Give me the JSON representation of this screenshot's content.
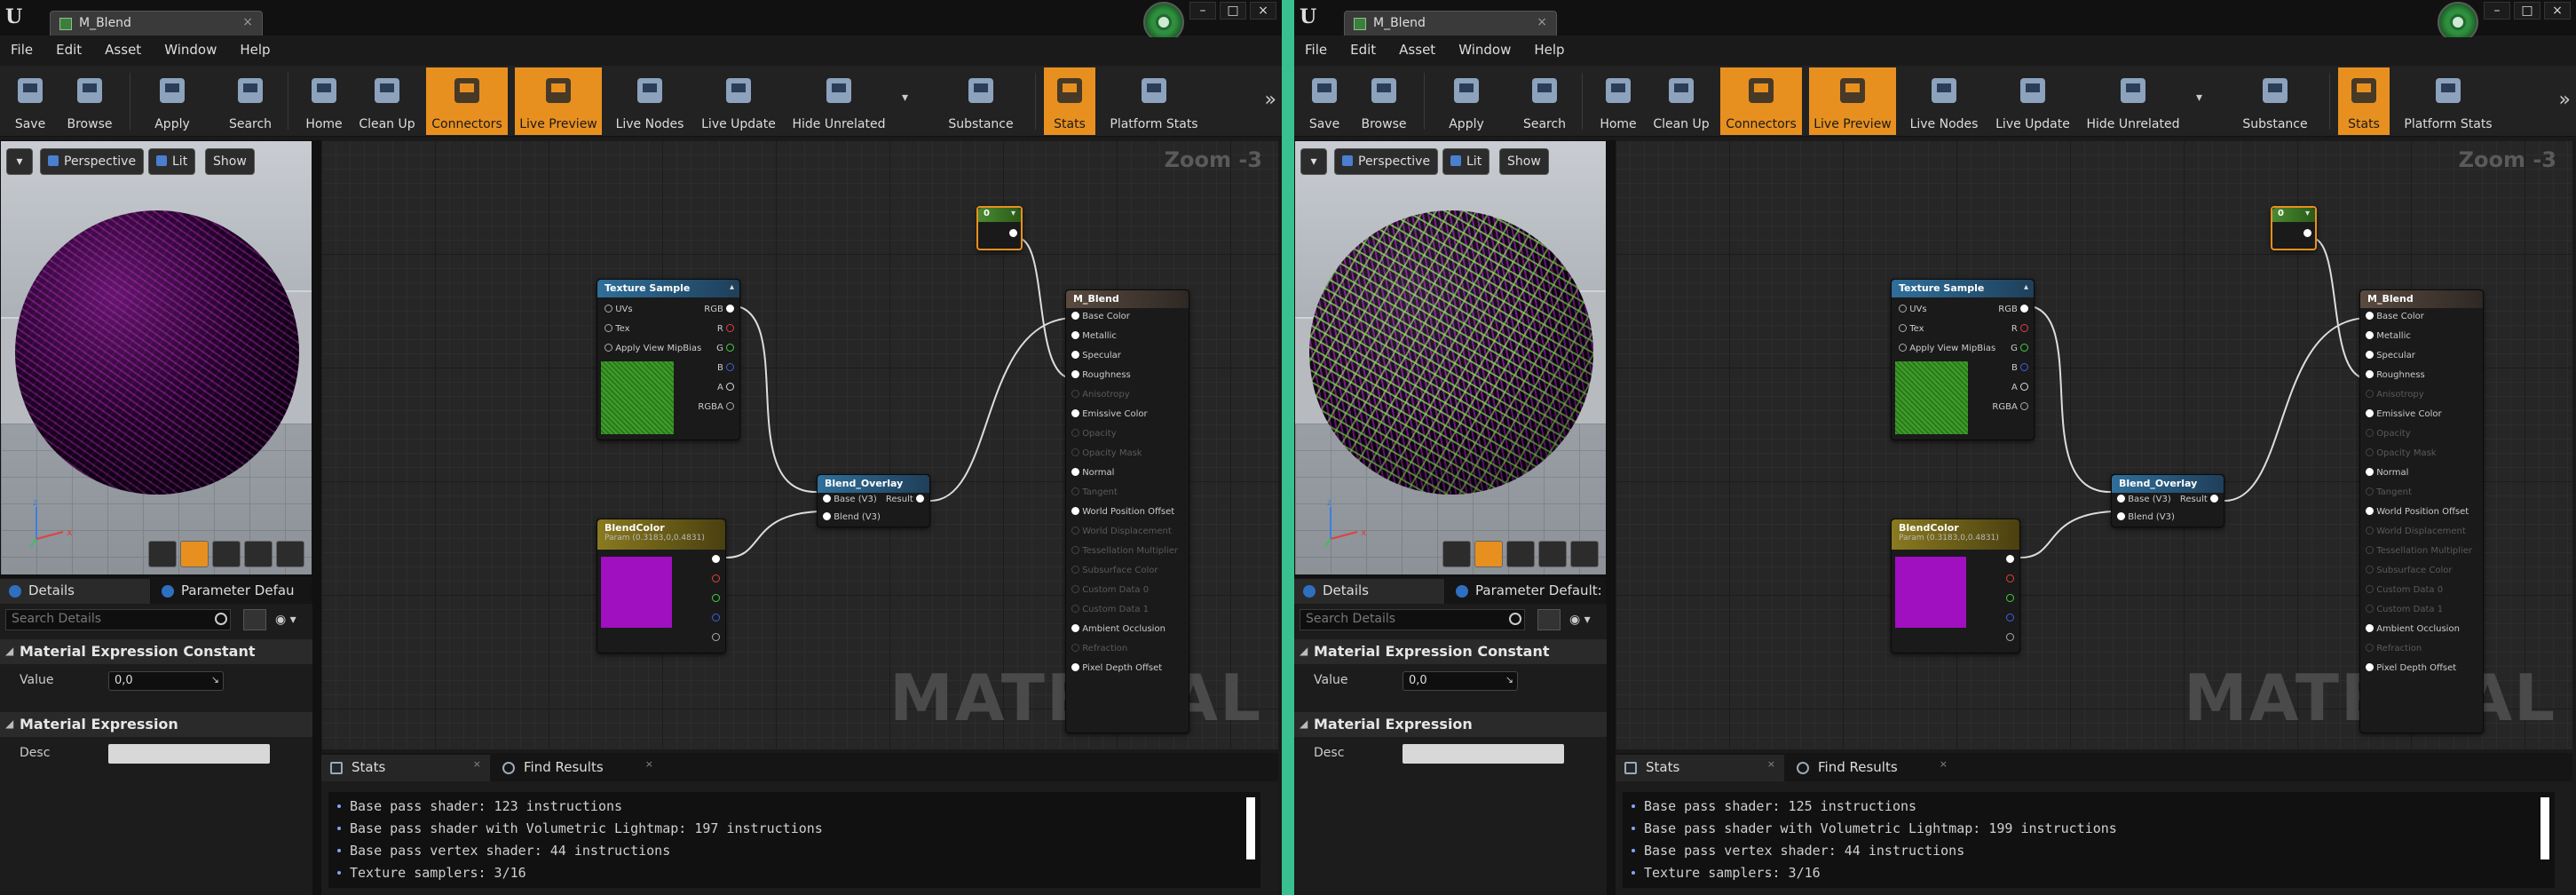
{
  "panes": [
    {
      "tab_title": "M_Blend",
      "tab_close": "×",
      "menu": [
        "File",
        "Edit",
        "Asset",
        "Window",
        "Help"
      ],
      "toolbar": [
        {
          "label": "Save",
          "icon": "save-icon",
          "active": false
        },
        {
          "label": "Browse",
          "icon": "browse-icon",
          "active": false
        },
        {
          "label": "Apply",
          "icon": "apply-icon",
          "active": false
        },
        {
          "label": "Search",
          "icon": "search-icon",
          "active": false
        },
        {
          "label": "Home",
          "icon": "home-icon",
          "active": false
        },
        {
          "label": "Clean Up",
          "icon": "clean-up-icon",
          "active": false
        },
        {
          "label": "Connectors",
          "icon": "connectors-icon",
          "active": true
        },
        {
          "label": "Live Preview",
          "icon": "live-preview-icon",
          "active": true
        },
        {
          "label": "Live Nodes",
          "icon": "live-nodes-icon",
          "active": false
        },
        {
          "label": "Live Update",
          "icon": "live-update-icon",
          "active": false
        },
        {
          "label": "Hide Unrelated",
          "icon": "hide-unrelated-icon",
          "active": false
        },
        {
          "label": "Substance",
          "icon": "substance-icon",
          "active": false
        },
        {
          "label": "Stats",
          "icon": "stats-icon",
          "active": true
        },
        {
          "label": "Platform Stats",
          "icon": "platform-stats-icon",
          "active": false
        }
      ],
      "viewport": {
        "perspective": "Perspective",
        "lit": "Lit",
        "show": "Show"
      },
      "details": {
        "tab_details": "Details",
        "tab_params": "Parameter Defau",
        "search_placeholder": "Search Details",
        "cat1": "Material Expression Constant",
        "value_label": "Value",
        "value": "0,0",
        "cat2": "Material Expression",
        "desc_label": "Desc"
      },
      "graph": {
        "zoom": "Zoom -3",
        "watermark": "MATERIAL",
        "texture_node": {
          "title": "Texture Sample",
          "inputs": [
            "UVs",
            "Tex",
            "Apply View MipBias"
          ],
          "outputs": [
            "RGB",
            "R",
            "G",
            "B",
            "A",
            "RGBA"
          ]
        },
        "blendcolor_node": {
          "title": "BlendColor",
          "subtitle": "Param (0.3183,0,0.4831)"
        },
        "overlay_node": {
          "title": "Blend_Overlay",
          "inputs": [
            "Base (V3)",
            "Blend (V3)"
          ],
          "output": "Result"
        },
        "const_node": {
          "value": "0"
        },
        "result_node": {
          "title": "M_Blend",
          "pins": [
            {
              "label": "Base Color",
              "dim": false
            },
            {
              "label": "Metallic",
              "dim": false
            },
            {
              "label": "Specular",
              "dim": false
            },
            {
              "label": "Roughness",
              "dim": false
            },
            {
              "label": "Anisotropy",
              "dim": true
            },
            {
              "label": "Emissive Color",
              "dim": false
            },
            {
              "label": "Opacity",
              "dim": true
            },
            {
              "label": "Opacity Mask",
              "dim": true
            },
            {
              "label": "Normal",
              "dim": false
            },
            {
              "label": "Tangent",
              "dim": true
            },
            {
              "label": "World Position Offset",
              "dim": false
            },
            {
              "label": "World Displacement",
              "dim": true
            },
            {
              "label": "Tessellation Multiplier",
              "dim": true
            },
            {
              "label": "Subsurface Color",
              "dim": true
            },
            {
              "label": "Custom Data 0",
              "dim": true
            },
            {
              "label": "Custom Data 1",
              "dim": true
            },
            {
              "label": "Ambient Occlusion",
              "dim": false
            },
            {
              "label": "Refraction",
              "dim": true
            },
            {
              "label": "Pixel Depth Offset",
              "dim": false
            }
          ]
        }
      },
      "bottom": {
        "tab_stats": "Stats",
        "tab_find": "Find Results",
        "lines": [
          "Base pass shader: 123 instructions",
          "Base pass shader with Volumetric Lightmap: 197 instructions",
          "Base pass vertex shader: 44 instructions",
          "Texture samplers: 3/16"
        ]
      }
    },
    {
      "tab_title": "M_Blend",
      "tab_close": "×",
      "menu": [
        "File",
        "Edit",
        "Asset",
        "Window",
        "Help"
      ],
      "toolbar": [
        {
          "label": "Save",
          "icon": "save-icon",
          "active": false
        },
        {
          "label": "Browse",
          "icon": "browse-icon",
          "active": false
        },
        {
          "label": "Apply",
          "icon": "apply-icon",
          "active": false
        },
        {
          "label": "Search",
          "icon": "search-icon",
          "active": false
        },
        {
          "label": "Home",
          "icon": "home-icon",
          "active": false
        },
        {
          "label": "Clean Up",
          "icon": "clean-up-icon",
          "active": false
        },
        {
          "label": "Connectors",
          "icon": "connectors-icon",
          "active": true
        },
        {
          "label": "Live Preview",
          "icon": "live-preview-icon",
          "active": true
        },
        {
          "label": "Live Nodes",
          "icon": "live-nodes-icon",
          "active": false
        },
        {
          "label": "Live Update",
          "icon": "live-update-icon",
          "active": false
        },
        {
          "label": "Hide Unrelated",
          "icon": "hide-unrelated-icon",
          "active": false
        },
        {
          "label": "Substance",
          "icon": "substance-icon",
          "active": false
        },
        {
          "label": "Stats",
          "icon": "stats-icon",
          "active": true
        },
        {
          "label": "Platform Stats",
          "icon": "platform-stats-icon",
          "active": false
        }
      ],
      "viewport": {
        "perspective": "Perspective",
        "lit": "Lit",
        "show": "Show"
      },
      "details": {
        "tab_details": "Details",
        "tab_params": "Parameter Default:",
        "search_placeholder": "Search Details",
        "cat1": "Material Expression Constant",
        "value_label": "Value",
        "value": "0,0",
        "cat2": "Material Expression",
        "desc_label": "Desc"
      },
      "graph": {
        "zoom": "Zoom -3",
        "watermark": "MATERIAL",
        "texture_node": {
          "title": "Texture Sample",
          "inputs": [
            "UVs",
            "Tex",
            "Apply View MipBias"
          ],
          "outputs": [
            "RGB",
            "R",
            "G",
            "B",
            "A",
            "RGBA"
          ]
        },
        "blendcolor_node": {
          "title": "BlendColor",
          "subtitle": "Param (0.3183,0,0.4831)"
        },
        "overlay_node": {
          "title": "Blend_Overlay",
          "inputs": [
            "Base (V3)",
            "Blend (V3)"
          ],
          "output": "Result"
        },
        "const_node": {
          "value": "0"
        },
        "result_node": {
          "title": "M_Blend",
          "pins": [
            {
              "label": "Base Color",
              "dim": false
            },
            {
              "label": "Metallic",
              "dim": false
            },
            {
              "label": "Specular",
              "dim": false
            },
            {
              "label": "Roughness",
              "dim": false
            },
            {
              "label": "Anisotropy",
              "dim": true
            },
            {
              "label": "Emissive Color",
              "dim": false
            },
            {
              "label": "Opacity",
              "dim": true
            },
            {
              "label": "Opacity Mask",
              "dim": true
            },
            {
              "label": "Normal",
              "dim": false
            },
            {
              "label": "Tangent",
              "dim": true
            },
            {
              "label": "World Position Offset",
              "dim": false
            },
            {
              "label": "World Displacement",
              "dim": true
            },
            {
              "label": "Tessellation Multiplier",
              "dim": true
            },
            {
              "label": "Subsurface Color",
              "dim": true
            },
            {
              "label": "Custom Data 0",
              "dim": true
            },
            {
              "label": "Custom Data 1",
              "dim": true
            },
            {
              "label": "Ambient Occlusion",
              "dim": false
            },
            {
              "label": "Refraction",
              "dim": true
            },
            {
              "label": "Pixel Depth Offset",
              "dim": false
            }
          ]
        }
      },
      "bottom": {
        "tab_stats": "Stats",
        "tab_find": "Find Results",
        "lines": [
          "Base pass shader: 125 instructions",
          "Base pass shader with Volumetric Lightmap: 199 instructions",
          "Base pass vertex shader: 44 instructions",
          "Texture samplers: 3/16"
        ]
      }
    }
  ],
  "colors": {
    "accent_orange": "#e8901f",
    "divider_green": "#39c090",
    "blend_purple": "#a010c0",
    "texture_green": "#3f9e2a"
  }
}
